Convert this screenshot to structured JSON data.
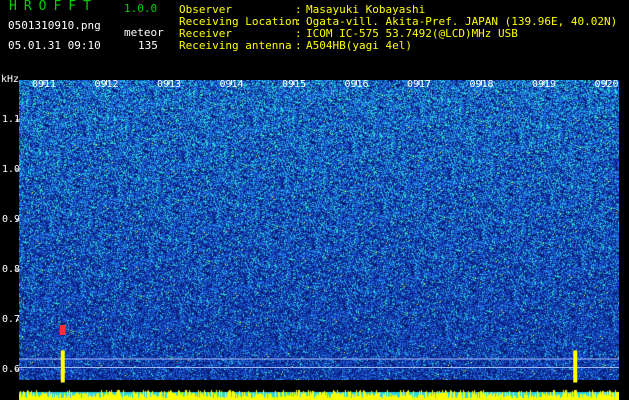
{
  "header": {
    "app_title": "HROFFT",
    "app_version": "1.0.0",
    "file_name": "0501310910.png",
    "mode": "meteor",
    "timestamp": "05.01.31 09:10",
    "count": "135"
  },
  "station": [
    {
      "label": "Observer",
      "value": "Masayuki Kobayashi"
    },
    {
      "label": "Receiving Location",
      "value": "Ogata-vill. Akita-Pref. JAPAN (139.96E, 40.02N)"
    },
    {
      "label": "Receiver",
      "value": "ICOM IC-575 53.7492(@LCD)MHz USB"
    },
    {
      "label": "Receiving antenna",
      "value": "A504HB(yagi 4el)"
    }
  ],
  "colors": {
    "background": "#000000",
    "low_signal": "#0a1a7a",
    "mid_signal": "#1e6ee6",
    "high_signal": "#29e0d0",
    "peak_signal": "#ffff00",
    "meteor_echo": "#ff3030"
  },
  "chart_data": {
    "type": "heatmap",
    "title": "",
    "ylabel": "kHz",
    "xlabel": "",
    "y_tick_labels": [
      "1.1",
      "1.0",
      "0.9",
      "0.8",
      "0.7",
      "0.6"
    ],
    "y_ticks": [
      1.1,
      1.0,
      0.9,
      0.8,
      0.7,
      0.6
    ],
    "ylim": [
      0.58,
      1.18
    ],
    "x_tick_labels": [
      "0911",
      "0912",
      "0913",
      "0914",
      "0915",
      "0916",
      "0917",
      "0918",
      "0919",
      "0920"
    ],
    "x_ticks_min": [
      1,
      2,
      3,
      4,
      5,
      6,
      7,
      8,
      9,
      10
    ],
    "xlim_min": [
      0.6,
      10.2
    ],
    "reference_lines_khz": [
      0.622,
      0.605
    ],
    "events": [
      {
        "time_min": 1.3,
        "freq_khz": 0.68,
        "kind": "meteor_echo"
      },
      {
        "time_min": 1.3,
        "freq_khz": 0.615,
        "kind": "strong_echo"
      },
      {
        "time_min": 9.5,
        "freq_khz": 0.615,
        "kind": "strong_echo"
      }
    ]
  }
}
